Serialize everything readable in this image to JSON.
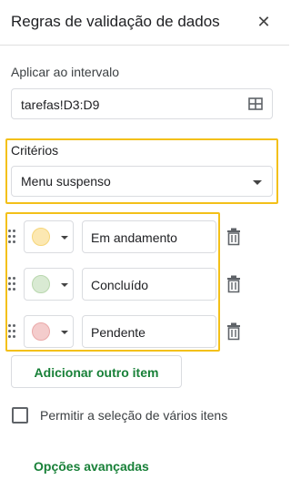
{
  "header": {
    "title": "Regras de validação de dados",
    "close_icon": "close-icon"
  },
  "range": {
    "label": "Aplicar ao intervalo",
    "value": "tarefas!D3:D9",
    "icon": "grid-select-icon"
  },
  "criteria": {
    "label": "Critérios",
    "selected": "Menu suspenso"
  },
  "items": [
    {
      "label": "Em andamento",
      "color": "#fce8b2"
    },
    {
      "label": "Concluído",
      "color": "#d9ead3"
    },
    {
      "label": "Pendente",
      "color": "#f4cccc"
    }
  ],
  "actions": {
    "add_item": "Adicionar outro item",
    "allow_multiple": "Permitir a seleção de vários itens",
    "advanced": "Opções avançadas"
  },
  "colors": {
    "highlight": "#f3c019",
    "green": "#188038"
  }
}
